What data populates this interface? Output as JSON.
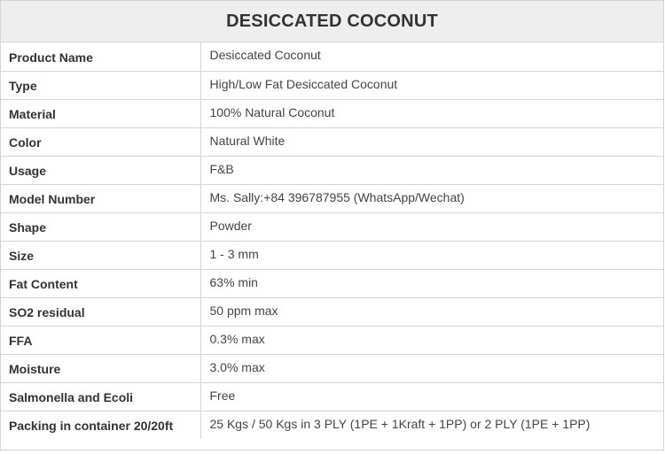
{
  "title": "DESICCATED COCONUT",
  "rows": [
    {
      "label": "Product Name",
      "value": "Desiccated Coconut"
    },
    {
      "label": "Type",
      "value": "High/Low Fat Desiccated Coconut"
    },
    {
      "label": "Material",
      "value": "100% Natural Coconut"
    },
    {
      "label": "Color",
      "value": "Natural White"
    },
    {
      "label": "Usage",
      "value": "F&B"
    },
    {
      "label": "Model Number",
      "value": "Ms. Sally:+84 396787955 (WhatsApp/Wechat)"
    },
    {
      "label": "Shape",
      "value": "Powder"
    },
    {
      "label": "Size",
      "value": "1 - 3 mm"
    },
    {
      "label": "Fat Content",
      "value": "63% min"
    },
    {
      "label": "SO2 residual",
      "value": "50 ppm max"
    },
    {
      "label": "FFA",
      "value": "0.3% max"
    },
    {
      "label": "Moisture",
      "value": "3.0% max"
    },
    {
      "label": "Salmonella and Ecoli",
      "value": "Free"
    },
    {
      "label": "Packing in container 20/20ft",
      "value": "25 Kgs / 50 Kgs in 3 PLY (1PE + 1Kraft + 1PP) or 2 PLY (1PE + 1PP)"
    }
  ]
}
